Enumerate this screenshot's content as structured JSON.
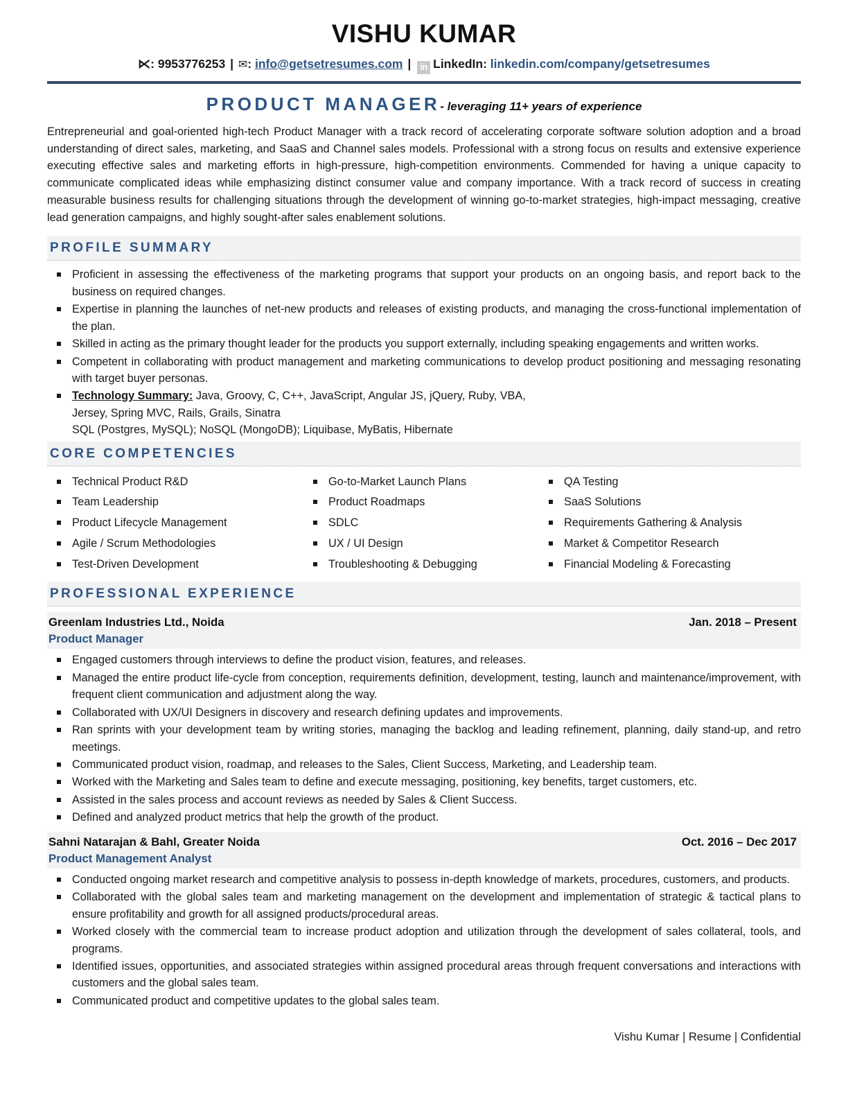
{
  "header": {
    "name": "VISHU KUMAR",
    "phone_icon": "phone-icon",
    "phone": ": 9953776253",
    "sep1": "|",
    "mail_icon": "✉",
    "mail_colon": ":",
    "email": "info@getsetresumes.com",
    "sep2": "|",
    "linkedin_badge": "in",
    "linkedin_label": "LinkedIn:",
    "linkedin_url": "linkedin.com/company/getsetresumes"
  },
  "headline": {
    "role": "PRODUCT MANAGER",
    "tagline": "- leveraging 11+ years of experience"
  },
  "intro": "Entrepreneurial and goal-oriented high-tech Product Manager with a track record of accelerating corporate software solution adoption and a broad understanding of direct sales, marketing, and SaaS and Channel sales models. Professional with a strong focus on results and extensive experience executing effective sales and marketing efforts in high-pressure, high-competition environments. Commended for having a unique capacity to communicate complicated ideas while emphasizing distinct consumer value and company importance. With a track record of success in creating measurable business results for challenging situations through the development of winning go-to-market strategies, high-impact messaging, creative lead generation campaigns, and highly sought-after sales enablement solutions.",
  "sections": {
    "profile_summary": "PROFILE SUMMARY",
    "core_competencies": "CORE COMPETENCIES",
    "professional_experience": "PROFESSIONAL EXPERIENCE"
  },
  "profile_summary": {
    "bullets": [
      "Proficient in assessing the effectiveness of the marketing programs that support your products on an ongoing basis, and report back to the business on required changes.",
      "Expertise in planning the launches of net-new products and releases of existing products, and managing the cross-functional implementation of the plan.",
      "Skilled in acting as the primary thought leader for the products you support externally, including speaking engagements and written works.",
      "Competent in collaborating with product management and marketing communications to develop product positioning and messaging resonating with target buyer personas."
    ],
    "technology": {
      "label": "Technology Summary:",
      "line1": " Java, Groovy, C, C++, JavaScript, Angular JS, jQuery, Ruby, VBA,",
      "line2": "Jersey, Spring MVC, Rails, Grails, Sinatra",
      "line3": "SQL (Postgres, MySQL); NoSQL (MongoDB); Liquibase, MyBatis, Hibernate"
    }
  },
  "core_competencies": {
    "column1": [
      "Technical Product R&D",
      "Team Leadership",
      "Product Lifecycle Management",
      "Agile / Scrum Methodologies",
      "Test-Driven Development"
    ],
    "column2": [
      "Go-to-Market Launch Plans",
      "Product Roadmaps",
      "SDLC",
      "UX / UI Design",
      "Troubleshooting & Debugging"
    ],
    "column3": [
      "QA Testing",
      "SaaS Solutions",
      "Requirements Gathering & Analysis",
      "Market & Competitor Research",
      "Financial Modeling & Forecasting"
    ]
  },
  "experience": [
    {
      "company": "Greenlam Industries Ltd., Noida",
      "dates": "Jan. 2018 – Present",
      "title": "Product Manager",
      "bullets": [
        "Engaged customers through interviews to define the product vision, features, and releases.",
        "Managed the entire product life-cycle from conception, requirements definition, development, testing, launch and maintenance/improvement, with frequent client communication and adjustment along the way.",
        "Collaborated with UX/UI Designers in discovery and research defining updates and improvements.",
        "Ran sprints with your development team by writing stories, managing the backlog and leading refinement, planning, daily stand-up, and retro meetings.",
        "Communicated product vision, roadmap, and releases to the Sales, Client Success, Marketing, and Leadership team.",
        "Worked with the Marketing and Sales team to define and execute messaging, positioning, key benefits, target customers, etc.",
        "Assisted in the sales process and account reviews as needed by Sales & Client Success.",
        "Defined and analyzed product metrics that help the growth of the product."
      ]
    },
    {
      "company": "Sahni Natarajan & Bahl, Greater Noida",
      "dates": "Oct. 2016 – Dec 2017",
      "title": "Product Management Analyst",
      "bullets": [
        "Conducted ongoing market research and competitive analysis to possess in-depth knowledge of markets, procedures, customers, and products.",
        "Collaborated with the global sales team and marketing management on the development and implementation of strategic & tactical plans to ensure profitability and growth for all assigned products/procedural areas.",
        "Worked closely with the commercial team to increase product adoption and utilization through the development of sales collateral, tools, and programs.",
        "Identified issues, opportunities, and associated strategies within assigned procedural areas through frequent conversations and interactions with customers and the global sales team.",
        "Communicated product and competitive updates to the global sales team."
      ]
    }
  ],
  "footer": "Vishu Kumar | Resume | Confidential",
  "colors": {
    "accent_blue": "#2e5482",
    "rule_navy": "#36486b",
    "section_bg": "#f1f2f4"
  }
}
